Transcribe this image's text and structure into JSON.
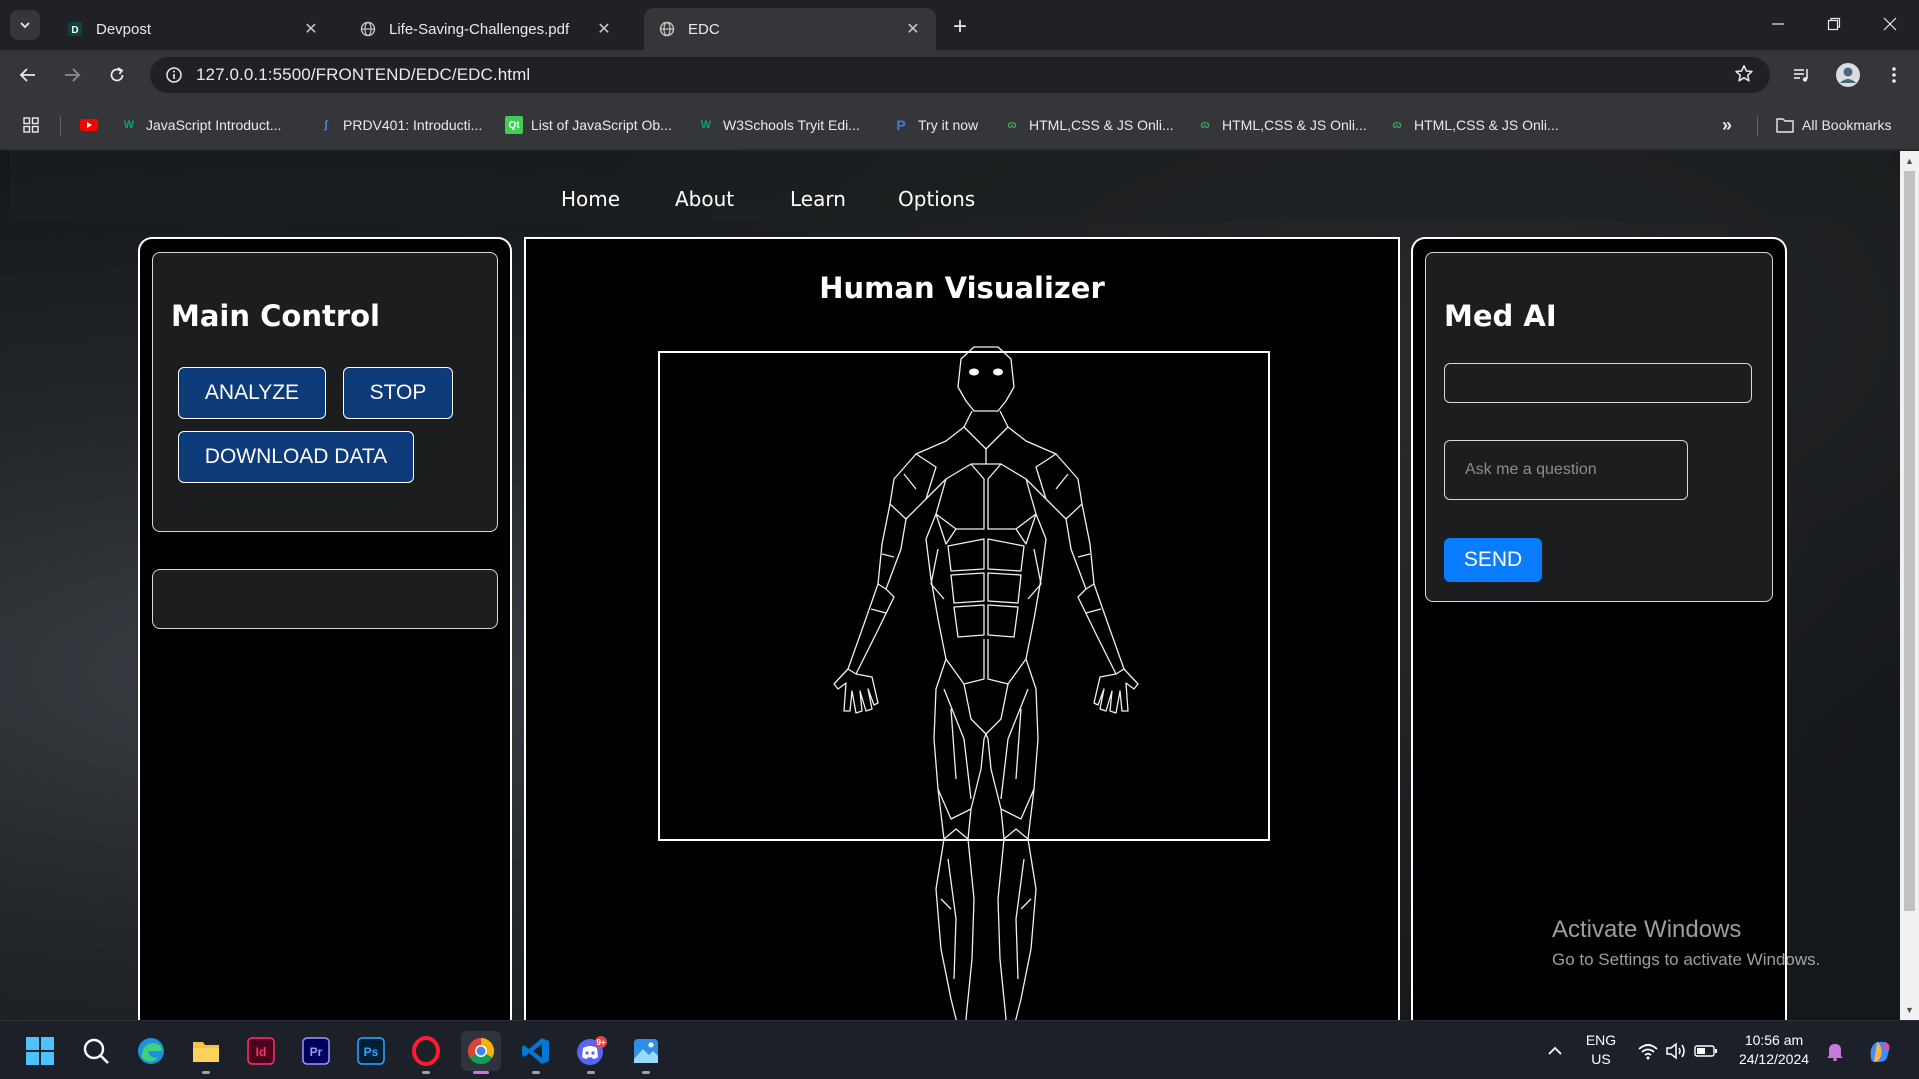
{
  "browser": {
    "tabs": [
      {
        "title": "Devpost",
        "favicon": "devpost-icon",
        "active": false
      },
      {
        "title": "Life-Saving-Challenges.pdf",
        "favicon": "globe-icon",
        "active": false
      },
      {
        "title": "EDC",
        "favicon": "globe-icon",
        "active": true
      }
    ],
    "url": "127.0.0.1:5500/FRONTEND/EDC/EDC.html",
    "bookmarks": [
      {
        "label": "",
        "icon": "youtube-icon"
      },
      {
        "label": "JavaScript Introduct...",
        "icon": "w3schools-icon"
      },
      {
        "label": "PRDV401: Introducti...",
        "icon": "saylor-icon"
      },
      {
        "label": "List of JavaScript Ob...",
        "icon": "qt-icon"
      },
      {
        "label": "W3Schools Tryit Edi...",
        "icon": "w3schools-icon"
      },
      {
        "label": "Try it now",
        "icon": "p-icon"
      },
      {
        "label": "HTML,CSS & JS Onli...",
        "icon": "oc-icon"
      },
      {
        "label": "HTML,CSS & JS Onli...",
        "icon": "oc-icon"
      },
      {
        "label": "HTML,CSS & JS Onli...",
        "icon": "oc-icon"
      }
    ],
    "all_bookmarks": "All Bookmarks"
  },
  "nav": {
    "links": [
      "Home",
      "About",
      "Learn",
      "Options"
    ]
  },
  "main_control": {
    "title": "Main Control",
    "analyze_label": "ANALYZE",
    "stop_label": "STOP",
    "download_label": "DOWNLOAD DATA"
  },
  "visualizer": {
    "title": "Human Visualizer"
  },
  "med_ai": {
    "title": "Med AI",
    "response_value": "",
    "question_placeholder": "Ask me a question",
    "send_label": "SEND"
  },
  "watermark": {
    "line1": "Activate Windows",
    "line2": "Go to Settings to activate Windows."
  },
  "taskbar": {
    "apps": [
      "windows-start-icon",
      "search-icon",
      "edge-icon",
      "file-explorer-icon",
      "indesign-icon",
      "premiere-icon",
      "photoshop-icon",
      "opera-icon",
      "chrome-icon",
      "vscode-icon",
      "discord-icon",
      "photos-icon"
    ],
    "indesign_label": "Id",
    "premiere_label": "Pr",
    "photoshop_label": "Ps",
    "discord_badge": "9+",
    "lang_line1": "ENG",
    "lang_line2": "US",
    "time": "10:56 am",
    "date": "24/12/2024"
  }
}
